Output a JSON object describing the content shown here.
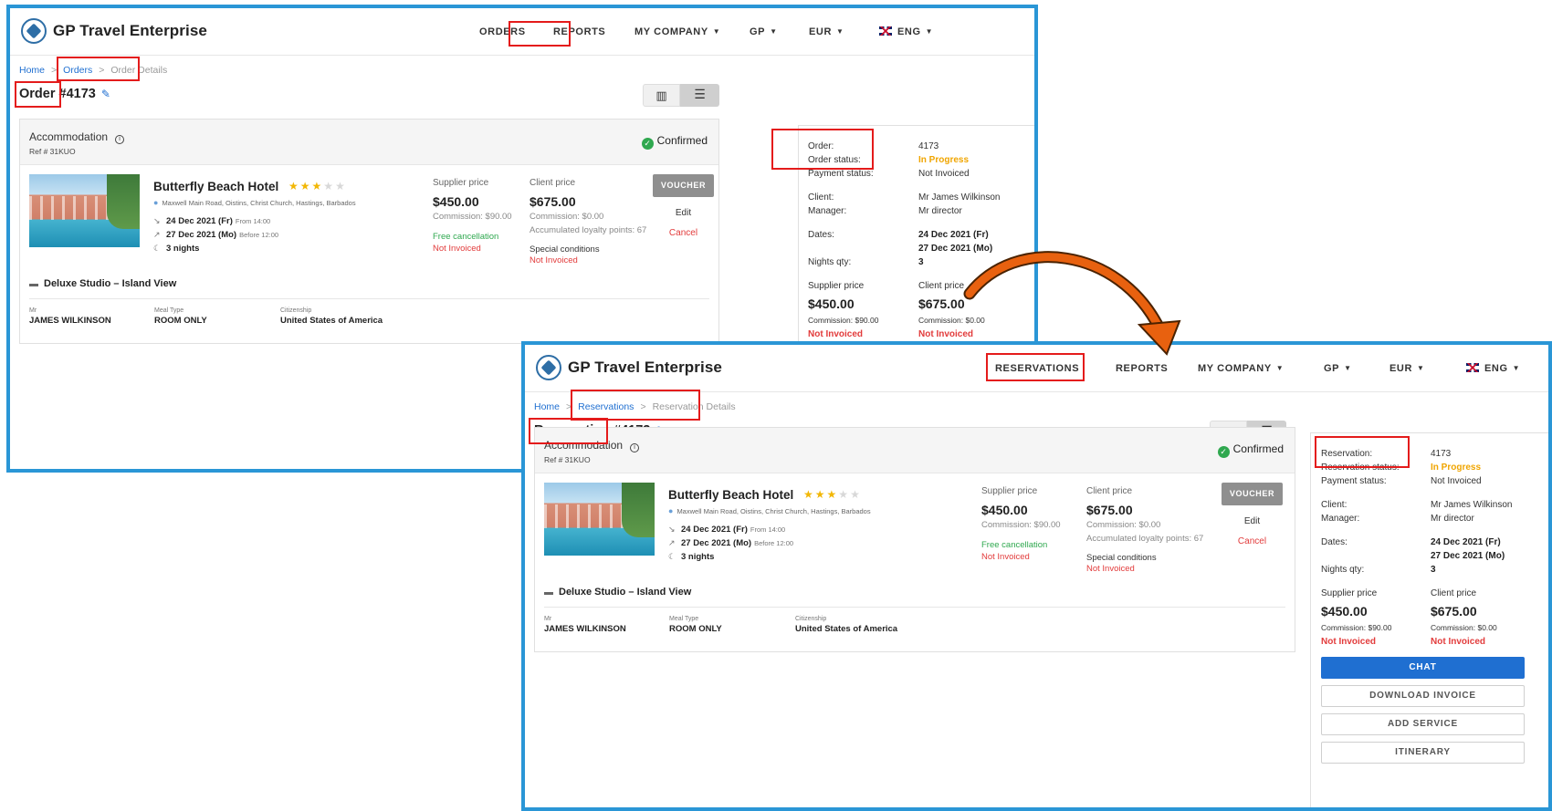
{
  "before": {
    "brand": "GP Travel Enterprise",
    "nav": [
      "ORDERS",
      "REPORTS",
      "MY COMPANY",
      "GP",
      "EUR",
      "ENG"
    ],
    "breadcrumb": [
      "Home",
      "Orders",
      "Order Details"
    ],
    "title_word": "Order",
    "title_num": "#4173",
    "card": {
      "section": "Accommodation",
      "ref": "Ref # 31KUO",
      "status": "Confirmed",
      "hotel": "Butterfly Beach Hotel",
      "address": "Maxwell Main Road, Oistins, Christ Church, Hastings, Barbados",
      "checkin": "24 Dec 2021 (Fr)",
      "checkin_time": "From 14:00",
      "checkout": "27 Dec 2021 (Mo)",
      "checkout_time": "Before 12:00",
      "nights": "3 nights",
      "supplier_label": "Supplier price",
      "supplier_price": "$450.00",
      "supplier_comm": "Commission: $90.00",
      "free_cancel": "Free cancellation",
      "not_invoiced": "Not Invoiced",
      "client_label": "Client price",
      "client_price": "$675.00",
      "client_comm": "Commission: $0.00",
      "loyalty": "Accumulated loyalty points: 67",
      "special": "Special conditions",
      "voucher": "VOUCHER",
      "edit": "Edit",
      "cancel": "Cancel",
      "room": "Deluxe Studio – Island View",
      "guest_title_label": "Mr",
      "guest_name": "JAMES WILKINSON",
      "meal_label": "Meal Type",
      "meal": "ROOM ONLY",
      "citizen_label": "Citizenship",
      "citizen": "United States of America"
    },
    "side": {
      "order_label": "Order:",
      "order_val": "4173",
      "status_label": "Order status:",
      "status_val": "In Progress",
      "payment_label": "Payment status:",
      "payment_val": "Not Invoiced",
      "client_label": "Client:",
      "client_val": "Mr James Wilkinson",
      "manager_label": "Manager:",
      "manager_val": "Mr director",
      "dates_label": "Dates:",
      "date_from": "24 Dec 2021 (Fr)",
      "date_to": "27 Dec 2021 (Mo)",
      "nights_label": "Nights qty:",
      "nights_val": "3",
      "sp_label": "Supplier price",
      "sp_val": "$450.00",
      "sp_comm": "Commission: $90.00",
      "sp_status": "Not Invoiced",
      "cp_label": "Client price",
      "cp_val": "$675.00",
      "cp_comm": "Commission: $0.00",
      "cp_status": "Not Invoiced"
    }
  },
  "after": {
    "brand": "GP Travel Enterprise",
    "nav": [
      "RESERVATIONS",
      "REPORTS",
      "MY COMPANY",
      "GP",
      "EUR",
      "ENG"
    ],
    "breadcrumb": [
      "Home",
      "Reservations",
      "Reservation Details"
    ],
    "title_word": "Reservation",
    "title_num": "#4173",
    "card": {
      "section": "Accommodation",
      "ref": "Ref # 31KUO",
      "status": "Confirmed",
      "hotel": "Butterfly Beach Hotel",
      "address": "Maxwell Main Road, Oistins, Christ Church, Hastings, Barbados",
      "checkin": "24 Dec 2021 (Fr)",
      "checkin_time": "From 14:00",
      "checkout": "27 Dec 2021 (Mo)",
      "checkout_time": "Before 12:00",
      "nights": "3 nights",
      "supplier_label": "Supplier price",
      "supplier_price": "$450.00",
      "supplier_comm": "Commission: $90.00",
      "free_cancel": "Free cancellation",
      "not_invoiced": "Not Invoiced",
      "client_label": "Client price",
      "client_price": "$675.00",
      "client_comm": "Commission: $0.00",
      "loyalty": "Accumulated loyalty points: 67",
      "special": "Special conditions",
      "voucher": "VOUCHER",
      "edit": "Edit",
      "cancel": "Cancel",
      "room": "Deluxe Studio – Island View",
      "guest_title_label": "Mr",
      "guest_name": "JAMES WILKINSON",
      "meal_label": "Meal Type",
      "meal": "ROOM ONLY",
      "citizen_label": "Citizenship",
      "citizen": "United States of America"
    },
    "side": {
      "order_label": "Reservation:",
      "order_val": "4173",
      "status_label": "Reservation status:",
      "status_val": "In Progress",
      "payment_label": "Payment status:",
      "payment_val": "Not Invoiced",
      "client_label": "Client:",
      "client_val": "Mr James Wilkinson",
      "manager_label": "Manager:",
      "manager_val": "Mr director",
      "dates_label": "Dates:",
      "date_from": "24 Dec 2021 (Fr)",
      "date_to": "27 Dec 2021 (Mo)",
      "nights_label": "Nights qty:",
      "nights_val": "3",
      "sp_label": "Supplier price",
      "sp_val": "$450.00",
      "sp_comm": "Commission: $90.00",
      "sp_status": "Not Invoiced",
      "cp_label": "Client price",
      "cp_val": "$675.00",
      "cp_comm": "Commission: $0.00",
      "cp_status": "Not Invoiced",
      "buttons": [
        "CHAT",
        "DOWNLOAD INVOICE",
        "ADD SERVICE",
        "ITINERARY"
      ]
    }
  },
  "icons": {
    "star_full": "★",
    "star_empty": "★",
    "pencil": "✎",
    "info": "i",
    "check": "✓",
    "pin": "●",
    "checkin": "↘",
    "checkout": "↗",
    "moon": "☾",
    "bed": "▬",
    "map": "▥",
    "list": "☰",
    "caret": "▼"
  },
  "colors": {
    "panel_border": "#2a96d6",
    "highlight": "#e41b1b",
    "link": "#1f6fd1",
    "confirmed": "#2fa84f",
    "in_progress": "#f0a500",
    "not_invoiced": "#e23b3b",
    "arrow": "#e8610f"
  }
}
